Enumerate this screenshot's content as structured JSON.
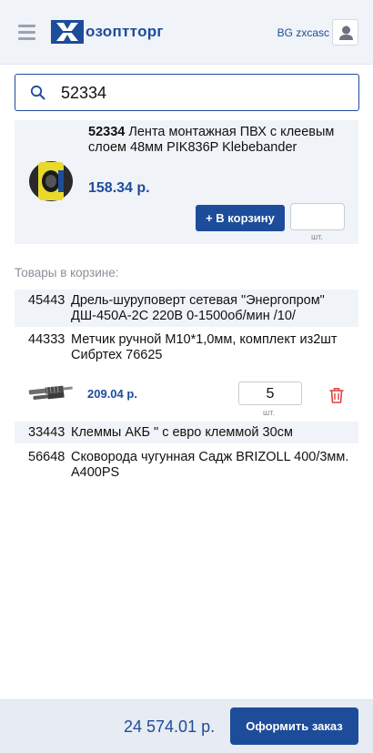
{
  "header": {
    "logo_text": "озоптторг",
    "user_name": "BG zxcasc"
  },
  "search": {
    "value": "52334",
    "placeholder": ""
  },
  "result": {
    "code": "52334",
    "name": " Лента монтажная ПВХ с клеевым слоем 48мм PIK836P Klebebander",
    "price": "158.34 р.",
    "add_label": "+ В корзину",
    "quantity": "",
    "unit": "шт."
  },
  "cart": {
    "heading": "Товары в корзине:",
    "items": [
      {
        "code": "45443",
        "name": "Дрель-шуруповерт сетевая \"Энергопром\" ДШ-450А-2С 220В 0-1500об/мин /10/"
      },
      {
        "code": "44333",
        "name": "Метчик ручной М10*1,0мм, комплект из2шт Сибртех 76625",
        "price": "209.04 р.",
        "quantity": "5",
        "unit": "шт."
      },
      {
        "code": "33443",
        "name": "Клеммы АКБ \" с евро клеммой 30см"
      },
      {
        "code": "56648",
        "name": "Сковорода чугунная Садж BRIZOLL 400/3мм. А400PS"
      }
    ]
  },
  "footer": {
    "total": "24 574.01 р.",
    "order_label": "Оформить заказ"
  },
  "colors": {
    "accent": "#1d4c9a",
    "panel": "#f0f3f8",
    "delete": "#e0413f"
  }
}
